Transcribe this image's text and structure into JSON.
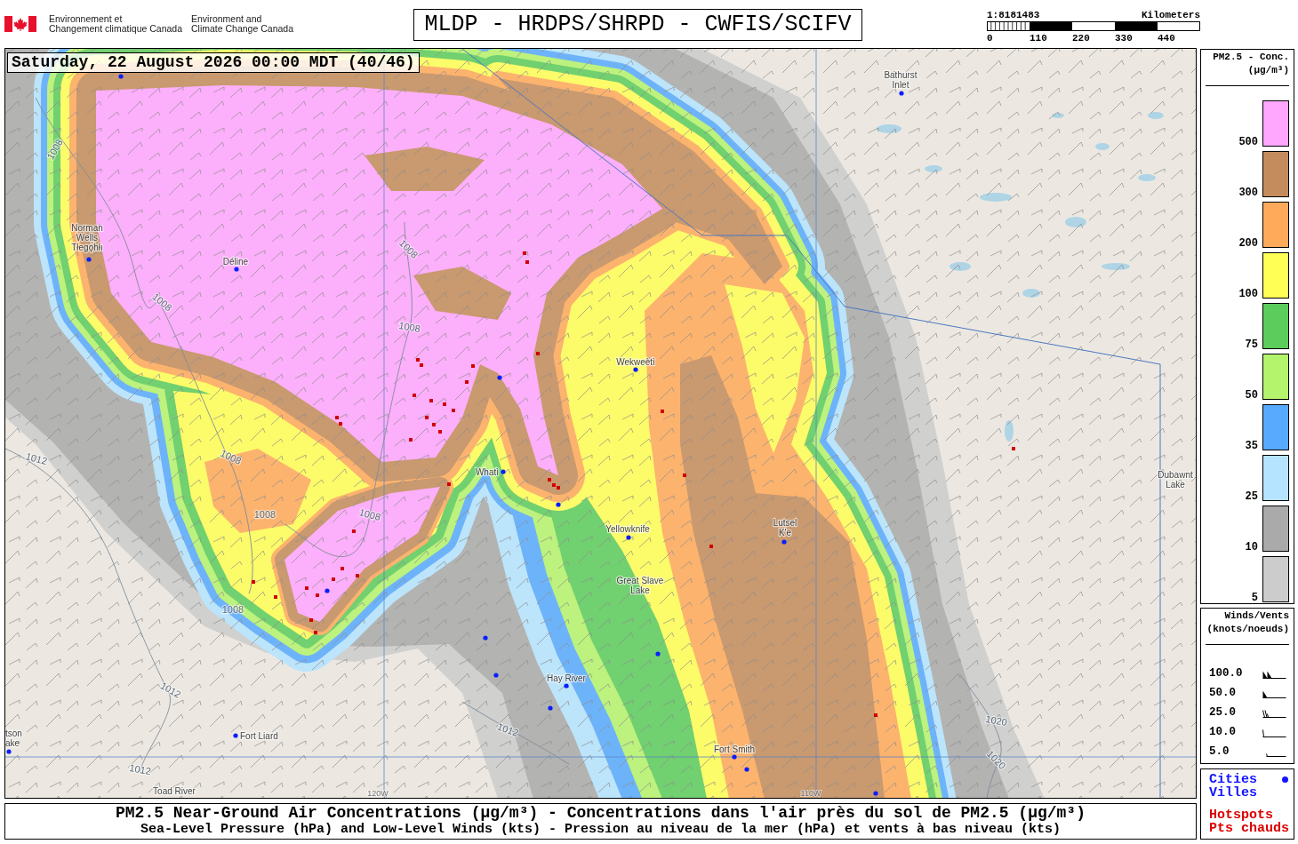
{
  "header": {
    "agency_fr": [
      "Environnement et",
      "Changement climatique Canada"
    ],
    "agency_en": [
      "Environment and",
      "Climate Change Canada"
    ],
    "title": "MLDP - HRDPS/SHRPD - CWFIS/SCIFV",
    "scale": {
      "ratio": "1:8181483",
      "unit": "Kilometers",
      "ticks": [
        "0",
        "110",
        "220",
        "330",
        "440"
      ]
    }
  },
  "map": {
    "timestamp": "Saturday, 22 August 2026 00:00 MDT (40/46)",
    "places": [
      {
        "kind": "city",
        "lines": [
          "Bathurst",
          "Inlet"
        ]
      },
      {
        "kind": "city",
        "lines": [
          "Déline"
        ]
      },
      {
        "kind": "city",
        "lines": [
          "Norman",
          "Wells",
          "Tłegǫ́hłı"
        ]
      },
      {
        "kind": "city",
        "lines": [
          "Wekweètì"
        ]
      },
      {
        "kind": "city",
        "lines": [
          "Whatì"
        ]
      },
      {
        "kind": "city",
        "lines": [
          "Yellowknife"
        ]
      },
      {
        "kind": "city",
        "lines": [
          "Lutsel",
          "K'e"
        ]
      },
      {
        "kind": "city",
        "lines": [
          "Hay River"
        ]
      },
      {
        "kind": "city",
        "lines": [
          "Fort Liard"
        ]
      },
      {
        "kind": "city",
        "lines": [
          "Fort Smith"
        ]
      },
      {
        "kind": "city",
        "lines": [
          "tson",
          "ake"
        ]
      },
      {
        "kind": "label",
        "lines": [
          "Toad River"
        ]
      },
      {
        "kind": "label",
        "lines": [
          "Dubawnt",
          "Lake"
        ]
      },
      {
        "kind": "label",
        "lines": [
          "Great Slave",
          "Lake"
        ]
      }
    ],
    "meridians": [
      "120W",
      "110W"
    ],
    "isobars": [
      "1008",
      "1008",
      "1008",
      "1008",
      "1008",
      "1008",
      "1008",
      "1008",
      "1012",
      "1012",
      "1012",
      "1012",
      "1020",
      "1020"
    ]
  },
  "legend": {
    "title": "PM2.5 - Conc.",
    "unit": "(µg/m³)",
    "levels": [
      {
        "label": "500",
        "color": "#ffa6ff"
      },
      {
        "label": "300",
        "color": "#c48c5c"
      },
      {
        "label": "200",
        "color": "#ffaa5a"
      },
      {
        "label": "100",
        "color": "#ffff55"
      },
      {
        "label": "75",
        "color": "#5ccc5c"
      },
      {
        "label": "50",
        "color": "#b4f46c"
      },
      {
        "label": "35",
        "color": "#58aaff"
      },
      {
        "label": "25",
        "color": "#b4e4ff"
      },
      {
        "label": "10",
        "color": "#aaaaaa"
      },
      {
        "label": "5",
        "color": "#cccccc"
      }
    ]
  },
  "winds": {
    "title": "Winds/Vents",
    "unit": "(knots/noeuds)",
    "entries": [
      {
        "label": "100.0",
        "kind": "double_pennant"
      },
      {
        "label": "50.0",
        "kind": "pennant"
      },
      {
        "label": "25.0",
        "kind": "barbs"
      },
      {
        "label": "10.0",
        "kind": "barb"
      },
      {
        "label": "5.0",
        "kind": "half_barb"
      }
    ]
  },
  "key": [
    {
      "kind": "city",
      "lines": [
        "Cities",
        "Villes"
      ]
    },
    {
      "kind": "hotspot",
      "lines": [
        "Hotspots",
        "Pts chauds"
      ]
    }
  ],
  "caption": [
    "PM2.5 Near-Ground Air Concentrations (µg/m³) - Concentrations dans l'air près du sol de PM2.5 (µg/m³)",
    "Sea-Level Pressure (hPa) and Low-Level Winds (kts) - Pression au niveau de la mer (hPa) et vents à bas niveau (kts)"
  ]
}
